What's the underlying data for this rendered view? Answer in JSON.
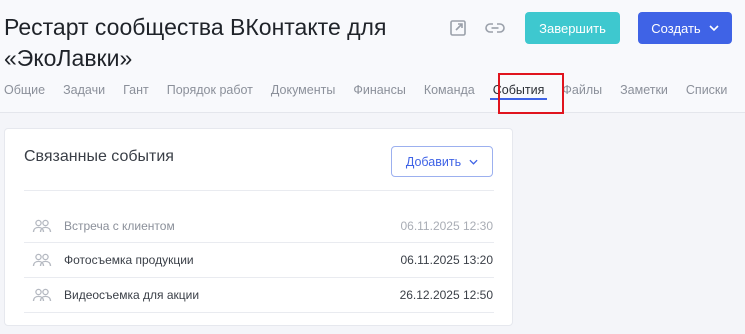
{
  "header": {
    "title": "Рестарт сообщества ВКонтакте для «ЭкоЛавки»",
    "finish_label": "Завершить",
    "create_label": "Создать"
  },
  "tabs": [
    {
      "label": "Общие"
    },
    {
      "label": "Задачи"
    },
    {
      "label": "Гант"
    },
    {
      "label": "Порядок работ"
    },
    {
      "label": "Документы"
    },
    {
      "label": "Финансы"
    },
    {
      "label": "Команда"
    },
    {
      "label": "События",
      "active": true
    },
    {
      "label": "Файлы"
    },
    {
      "label": "Заметки"
    },
    {
      "label": "Списки"
    }
  ],
  "card": {
    "title": "Связанные события",
    "add_label": "Добавить",
    "events": [
      {
        "name": "Встреча с клиентом",
        "datetime": "06.11.2025 12:30",
        "muted": true
      },
      {
        "name": "Фотосъемка продукции",
        "datetime": "06.11.2025 13:20",
        "muted": false
      },
      {
        "name": "Видеосъемка для акции",
        "datetime": "26.12.2025 12:50",
        "muted": false
      }
    ]
  },
  "colors": {
    "accent_blue": "#3f63e6",
    "finish_teal": "#3ec8cf",
    "highlight_red": "#e0141e"
  }
}
